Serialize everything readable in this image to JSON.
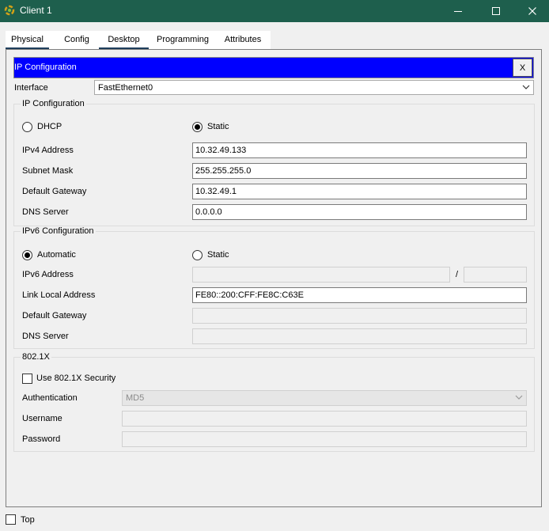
{
  "window": {
    "title": "Client 1"
  },
  "tabs": [
    "Physical",
    "Config",
    "Desktop",
    "Programming",
    "Attributes"
  ],
  "panel": {
    "title": "IP Configuration",
    "close_glyph": "X"
  },
  "interface": {
    "label": "Interface",
    "value": "FastEthernet0"
  },
  "ipv4": {
    "group_title": "IP Configuration",
    "dhcp_label": "DHCP",
    "static_label": "Static",
    "mode": "static",
    "fields": [
      {
        "label": "IPv4 Address",
        "value": "10.32.49.133"
      },
      {
        "label": "Subnet Mask",
        "value": "255.255.255.0"
      },
      {
        "label": "Default Gateway",
        "value": "10.32.49.1"
      },
      {
        "label": "DNS Server",
        "value": "0.0.0.0"
      }
    ]
  },
  "ipv6": {
    "group_title": "IPv6 Configuration",
    "automatic_label": "Automatic",
    "static_label": "Static",
    "mode": "automatic",
    "address_label": "IPv6 Address",
    "address_value": "",
    "prefix_separator": "/",
    "prefix_value": "",
    "link_local_label": "Link Local Address",
    "link_local_value": "FE80::200:CFF:FE8C:C63E",
    "gateway_label": "Default Gateway",
    "gateway_value": "",
    "dns_label": "DNS Server",
    "dns_value": ""
  },
  "dot1x": {
    "group_title": "802.1X",
    "use_security_label": "Use 802.1X Security",
    "use_security_checked": false,
    "auth_label": "Authentication",
    "auth_value": "MD5",
    "username_label": "Username",
    "username_value": "",
    "password_label": "Password",
    "password_value": ""
  },
  "footer": {
    "top_label": "Top",
    "top_checked": false
  },
  "colors": {
    "titlebar": "#1e5f4d",
    "header": "#0000ff",
    "tab_underline": "#1f3e5c"
  }
}
